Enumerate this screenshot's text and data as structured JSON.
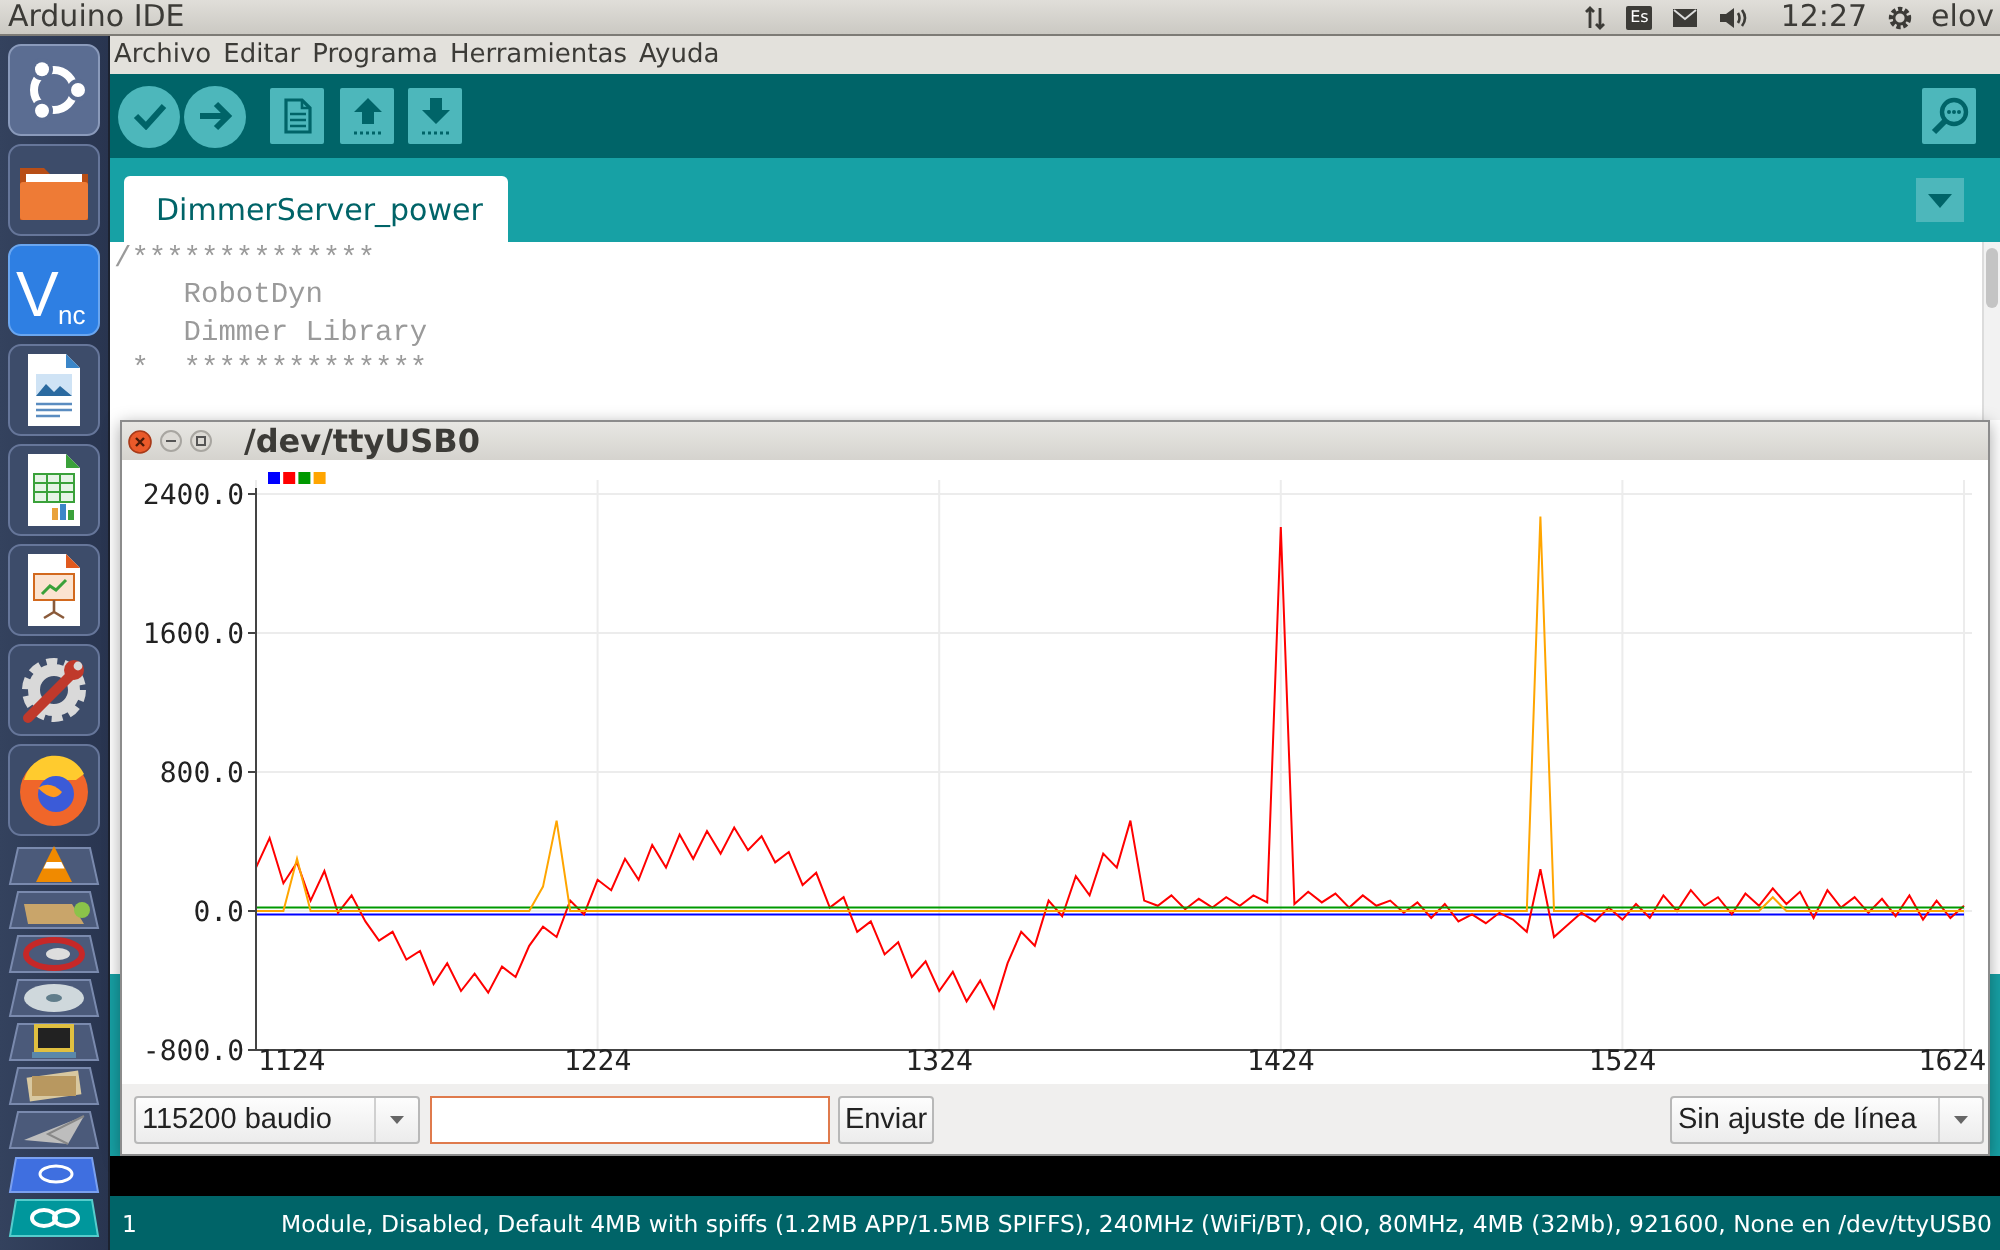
{
  "top_panel": {
    "title": "Arduino IDE",
    "keyboard_layout": "Es",
    "clock": "12:27",
    "user": "elov"
  },
  "launcher": [
    {
      "kind": "ubuntu"
    },
    {
      "kind": "folder"
    },
    {
      "kind": "vnc",
      "logo": [
        "V",
        "nc"
      ]
    },
    {
      "kind": "writer"
    },
    {
      "kind": "calc"
    },
    {
      "kind": "impress"
    },
    {
      "kind": "settings"
    },
    {
      "kind": "firefox"
    },
    {
      "kind": "cone"
    },
    {
      "kind": "package"
    },
    {
      "kind": "disc"
    },
    {
      "kind": "cd"
    },
    {
      "kind": "monitor"
    },
    {
      "kind": "photos"
    },
    {
      "kind": "plane"
    },
    {
      "kind": "cloud"
    },
    {
      "kind": "arduino"
    }
  ],
  "menu_bar": [
    "Archivo",
    "Editar",
    "Programa",
    "Herramientas",
    "Ayuda"
  ],
  "tabs": [
    {
      "label": "DimmerServer_power",
      "selected": true
    }
  ],
  "editor": {
    "lines": [
      "/**************",
      "    RobotDyn",
      "    Dimmer Library",
      " *  **************"
    ]
  },
  "serial_plotter": {
    "title": "/dev/ttyUSB0",
    "chart_data": {
      "type": "line",
      "x": [
        1124,
        1128,
        1132,
        1136,
        1140,
        1144,
        1148,
        1152,
        1156,
        1160,
        1164,
        1168,
        1172,
        1176,
        1180,
        1184,
        1188,
        1192,
        1196,
        1200,
        1204,
        1208,
        1212,
        1216,
        1220,
        1224,
        1228,
        1232,
        1236,
        1240,
        1244,
        1248,
        1252,
        1256,
        1260,
        1264,
        1268,
        1272,
        1276,
        1280,
        1284,
        1288,
        1292,
        1296,
        1300,
        1304,
        1308,
        1312,
        1316,
        1320,
        1324,
        1328,
        1332,
        1336,
        1340,
        1344,
        1348,
        1352,
        1356,
        1360,
        1364,
        1368,
        1372,
        1376,
        1380,
        1384,
        1388,
        1392,
        1396,
        1400,
        1404,
        1408,
        1412,
        1416,
        1420,
        1424,
        1428,
        1432,
        1436,
        1440,
        1444,
        1448,
        1452,
        1456,
        1460,
        1464,
        1468,
        1472,
        1476,
        1480,
        1484,
        1488,
        1492,
        1496,
        1500,
        1504,
        1508,
        1512,
        1516,
        1520,
        1524,
        1528,
        1532,
        1536,
        1540,
        1544,
        1548,
        1552,
        1556,
        1560,
        1564,
        1568,
        1572,
        1576,
        1580,
        1584,
        1588,
        1592,
        1596,
        1600,
        1604,
        1608,
        1612,
        1616,
        1620,
        1624
      ],
      "series": [
        {
          "color": "#0000ff",
          "values": [
            -20,
            -20,
            -20,
            -20,
            -20,
            -20,
            -20,
            -20,
            -20,
            -20,
            -20,
            -20,
            -20,
            -20,
            -20,
            -20,
            -20,
            -20,
            -20,
            -20,
            -20,
            -20,
            -20,
            -20,
            -20,
            -20,
            -20,
            -20,
            -20,
            -20,
            -20,
            -20,
            -20,
            -20,
            -20,
            -20,
            -20,
            -20,
            -20,
            -20,
            -20,
            -20,
            -20,
            -20,
            -20,
            -20,
            -20,
            -20,
            -20,
            -20,
            -20,
            -20,
            -20,
            -20,
            -20,
            -20,
            -20,
            -20,
            -20,
            -20,
            -20,
            -20,
            -20,
            -20,
            -20,
            -20,
            -20,
            -20,
            -20,
            -20,
            -20,
            -20,
            -20,
            -20,
            -20,
            -20,
            -20,
            -20,
            -20,
            -20,
            -20,
            -20,
            -20,
            -20,
            -20,
            -20,
            -20,
            -20,
            -20,
            -20,
            -20,
            -20,
            -20,
            -20,
            -20,
            -20,
            -20,
            -20,
            -20,
            -20,
            -20,
            -20,
            -20,
            -20,
            -20,
            -20,
            -20,
            -20,
            -20,
            -20,
            -20,
            -20,
            -20,
            -20,
            -20,
            -20,
            -20,
            -20,
            -20,
            -20,
            -20,
            -20,
            -20,
            -20,
            -20,
            -20
          ]
        },
        {
          "color": "#ff0000",
          "values": [
            250,
            420,
            160,
            280,
            60,
            230,
            -10,
            90,
            -60,
            -170,
            -120,
            -280,
            -230,
            -420,
            -300,
            -460,
            -360,
            -470,
            -320,
            -380,
            -200,
            -90,
            -150,
            60,
            -20,
            180,
            120,
            300,
            180,
            380,
            250,
            440,
            300,
            460,
            330,
            480,
            350,
            430,
            280,
            340,
            150,
            220,
            20,
            80,
            -120,
            -60,
            -250,
            -180,
            -380,
            -290,
            -460,
            -350,
            -520,
            -400,
            -560,
            -300,
            -120,
            -200,
            60,
            -30,
            200,
            90,
            330,
            250,
            520,
            60,
            30,
            90,
            10,
            70,
            20,
            80,
            30,
            90,
            50,
            2210,
            40,
            110,
            50,
            100,
            20,
            90,
            30,
            60,
            -10,
            50,
            -40,
            40,
            -60,
            -20,
            -70,
            -10,
            -50,
            -120,
            240,
            -150,
            -80,
            -10,
            -60,
            20,
            -50,
            40,
            -40,
            90,
            0,
            120,
            30,
            80,
            -20,
            100,
            30,
            130,
            40,
            110,
            -40,
            120,
            20,
            80,
            -10,
            70,
            -30,
            90,
            -50,
            60,
            -40,
            30
          ]
        },
        {
          "color": "#009900",
          "values": [
            20,
            20,
            20,
            20,
            20,
            20,
            20,
            20,
            20,
            20,
            20,
            20,
            20,
            20,
            20,
            20,
            20,
            20,
            20,
            20,
            20,
            20,
            20,
            20,
            20,
            20,
            20,
            20,
            20,
            20,
            20,
            20,
            20,
            20,
            20,
            20,
            20,
            20,
            20,
            20,
            20,
            20,
            20,
            20,
            20,
            20,
            20,
            20,
            20,
            20,
            20,
            20,
            20,
            20,
            20,
            20,
            20,
            20,
            20,
            20,
            20,
            20,
            20,
            20,
            20,
            20,
            20,
            20,
            20,
            20,
            20,
            20,
            20,
            20,
            20,
            20,
            20,
            20,
            20,
            20,
            20,
            20,
            20,
            20,
            20,
            20,
            20,
            20,
            20,
            20,
            20,
            20,
            20,
            20,
            20,
            20,
            20,
            20,
            20,
            20,
            20,
            20,
            20,
            20,
            20,
            20,
            20,
            20,
            20,
            20,
            20,
            20,
            20,
            20,
            20,
            20,
            20,
            20,
            20,
            20,
            20,
            20,
            20,
            20,
            20,
            20
          ]
        },
        {
          "color": "#ffa500",
          "values": [
            0,
            0,
            0,
            300,
            0,
            0,
            0,
            0,
            0,
            0,
            0,
            0,
            0,
            0,
            0,
            0,
            0,
            0,
            0,
            0,
            0,
            140,
            520,
            0,
            0,
            0,
            0,
            0,
            0,
            0,
            0,
            0,
            0,
            0,
            0,
            0,
            0,
            0,
            0,
            0,
            0,
            0,
            0,
            0,
            0,
            0,
            0,
            0,
            0,
            0,
            0,
            0,
            0,
            0,
            0,
            0,
            0,
            0,
            0,
            0,
            0,
            0,
            0,
            0,
            0,
            0,
            0,
            0,
            0,
            0,
            0,
            0,
            0,
            0,
            0,
            0,
            0,
            0,
            0,
            0,
            0,
            0,
            0,
            0,
            0,
            0,
            0,
            0,
            0,
            0,
            0,
            0,
            0,
            0,
            2270,
            0,
            0,
            0,
            0,
            0,
            0,
            0,
            0,
            0,
            0,
            0,
            0,
            0,
            0,
            0,
            0,
            80,
            0,
            0,
            0,
            0,
            0,
            0,
            0,
            0,
            0,
            0,
            0,
            0,
            0,
            0
          ]
        }
      ],
      "xlim": [
        1124,
        1624
      ],
      "ylim": [
        -800,
        2400
      ],
      "xticks": [
        1124,
        1224,
        1324,
        1424,
        1524,
        1624
      ],
      "yticks": [
        {
          "value": -800,
          "label": "-800.0"
        },
        {
          "value": 0,
          "label": "0.0"
        },
        {
          "value": 800,
          "label": "800.0"
        },
        {
          "value": 1600,
          "label": "1600.0"
        },
        {
          "value": 2400,
          "label": "2400.0"
        }
      ],
      "grid": true
    },
    "baud_rate": "115200 baudio",
    "message_field": {
      "focused": true
    },
    "send_button": "Enviar",
    "line_ending": "Sin ajuste de línea"
  },
  "status_bar": {
    "line_number": "1",
    "board": "Module, Disabled, Default 4MB with spiffs (1.2MB APP/1.5MB SPIFFS), 240MHz (WiFi/BT), QIO, 80MHz, 4MB (32Mb), 921600, None en /dev/ttyUSB0"
  }
}
